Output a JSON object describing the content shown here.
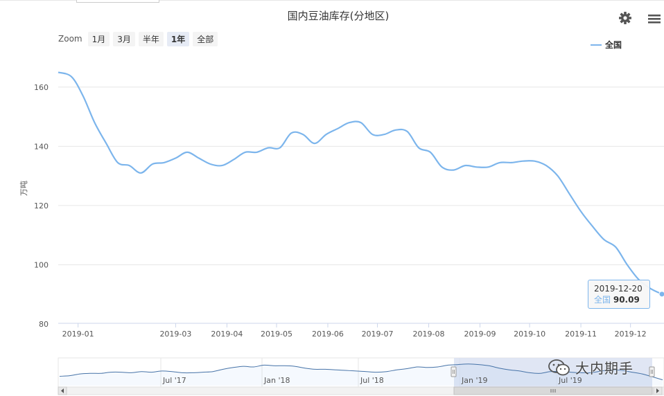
{
  "title": "国内豆油库存(分地区)",
  "zoom": {
    "label": "Zoom",
    "buttons": [
      "1月",
      "3月",
      "半年",
      "1年",
      "全部"
    ],
    "active": "1年"
  },
  "legend": {
    "name": "全国"
  },
  "watermark": "大内期手",
  "tooltip": {
    "date": "2019-12-20",
    "series": "全国",
    "value": "90.09"
  },
  "icons": {
    "settings": "gear-icon",
    "menu": "hamburger-menu-icon"
  },
  "colors": {
    "series": "#7cb5ec",
    "navigator_mask": "#d6def0"
  },
  "chart_data": {
    "type": "line",
    "ylabel": "万吨",
    "ylim": [
      80,
      170
    ],
    "yticks": [
      "160",
      "140",
      "120",
      "100",
      "80"
    ],
    "xticks": [
      "2019-01",
      "2019-03",
      "2019-04",
      "2019-05",
      "2019-06",
      "2019-07",
      "2019-08",
      "2019-09",
      "2019-10",
      "2019-11",
      "2019-12"
    ],
    "xrange": [
      "2018-12-20",
      "2019-12-20"
    ],
    "grid": true,
    "legend_position": "top-right",
    "series": [
      {
        "name": "全国",
        "x": [
          "2018-12-20",
          "2018-12-28",
          "2019-01-04",
          "2019-01-11",
          "2019-01-18",
          "2019-01-25",
          "2019-02-01",
          "2019-02-08",
          "2019-02-15",
          "2019-02-22",
          "2019-03-01",
          "2019-03-08",
          "2019-03-15",
          "2019-03-22",
          "2019-03-29",
          "2019-04-05",
          "2019-04-12",
          "2019-04-19",
          "2019-04-26",
          "2019-05-03",
          "2019-05-10",
          "2019-05-17",
          "2019-05-24",
          "2019-05-31",
          "2019-06-07",
          "2019-06-14",
          "2019-06-21",
          "2019-06-28",
          "2019-07-05",
          "2019-07-12",
          "2019-07-19",
          "2019-07-26",
          "2019-08-02",
          "2019-08-09",
          "2019-08-16",
          "2019-08-23",
          "2019-08-30",
          "2019-09-06",
          "2019-09-13",
          "2019-09-20",
          "2019-09-27",
          "2019-10-04",
          "2019-10-11",
          "2019-10-18",
          "2019-10-25",
          "2019-11-01",
          "2019-11-08",
          "2019-11-15",
          "2019-11-22",
          "2019-11-29",
          "2019-12-06",
          "2019-12-13",
          "2019-12-20"
        ],
        "values": [
          165.0,
          163.5,
          157.0,
          148.0,
          141.0,
          134.5,
          133.5,
          131.0,
          134.0,
          134.5,
          136.0,
          138.0,
          136.0,
          134.0,
          133.5,
          135.5,
          138.0,
          138.0,
          139.5,
          139.5,
          144.5,
          144.0,
          141.0,
          144.0,
          146.0,
          148.0,
          148.0,
          144.0,
          144.0,
          145.5,
          145.0,
          139.5,
          138.0,
          133.0,
          132.0,
          133.5,
          133.0,
          133.0,
          134.5,
          134.5,
          135.0,
          135.0,
          133.5,
          130.0,
          124.0,
          118.0,
          113.0,
          108.5,
          106.0,
          100.0,
          95.0,
          92.0,
          90.09
        ]
      }
    ],
    "navigator": {
      "xticks": [
        "Jul '17",
        "Jan '18",
        "Jul '18",
        "Jan '19",
        "Jul '19"
      ],
      "values": [
        156,
        157,
        160,
        161,
        161,
        163,
        163,
        162,
        164,
        163,
        165,
        164,
        162,
        162,
        163,
        164,
        168,
        171,
        173,
        172,
        175,
        174,
        174,
        173,
        170,
        168,
        168,
        167,
        166,
        165,
        164,
        163,
        164,
        167,
        169,
        172,
        171,
        172,
        175,
        176,
        177,
        176,
        174,
        170,
        167,
        165,
        162,
        161,
        164,
        164,
        163,
        162,
        162,
        165,
        167,
        166,
        163,
        160,
        155,
        150
      ]
    }
  }
}
